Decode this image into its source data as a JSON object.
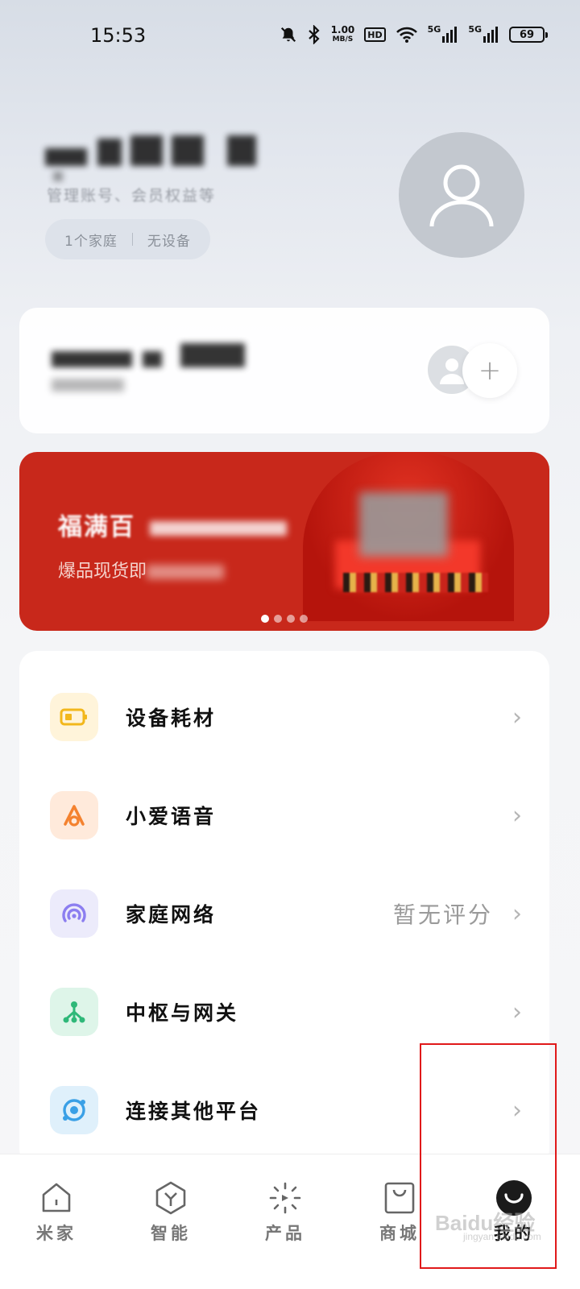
{
  "status_bar": {
    "time": "15:53",
    "speed_value": "1.00",
    "speed_unit": "MB/S",
    "hd_label": "HD",
    "network_1": "5G",
    "network_2": "5G",
    "battery": "69",
    "icons": [
      "mute-icon",
      "bluetooth-icon",
      "wifi-icon",
      "signal-icon",
      "signal-icon"
    ]
  },
  "profile": {
    "subtitle": "管理账号、会员权益等",
    "family_count": "1个家庭",
    "device_status": "无设备"
  },
  "banner": {
    "title": "福满百",
    "subtitle": "爆品现货即",
    "page_count": 4,
    "active_page": 0
  },
  "menu": {
    "items": [
      {
        "label": "设备耗材",
        "value": "",
        "icon": "battery-icon",
        "icon_bg": "#fff4da",
        "icon_color": "#f2b71c"
      },
      {
        "label": "小爱语音",
        "value": "",
        "icon": "xiaoai-icon",
        "icon_bg": "#ffeadb",
        "icon_color": "#f4822f"
      },
      {
        "label": "家庭网络",
        "value": "暂无评分",
        "icon": "network-icon",
        "icon_bg": "#ecebfb",
        "icon_color": "#8c7ef0"
      },
      {
        "label": "中枢与网关",
        "value": "",
        "icon": "hub-icon",
        "icon_bg": "#def5e9",
        "icon_color": "#2fb879"
      },
      {
        "label": "连接其他平台",
        "value": "",
        "icon": "connect-icon",
        "icon_bg": "#dff0fb",
        "icon_color": "#3aa0e6"
      }
    ]
  },
  "bottom_nav": {
    "items": [
      {
        "label": "米家",
        "icon": "home-icon"
      },
      {
        "label": "智能",
        "icon": "smart-icon"
      },
      {
        "label": "产品",
        "icon": "product-icon"
      },
      {
        "label": "商城",
        "icon": "shop-icon"
      },
      {
        "label": "我的",
        "icon": "profile-icon",
        "active": true
      }
    ]
  },
  "watermark": {
    "text": "Baidu经验",
    "sub": "jingyan.baidu.com"
  }
}
